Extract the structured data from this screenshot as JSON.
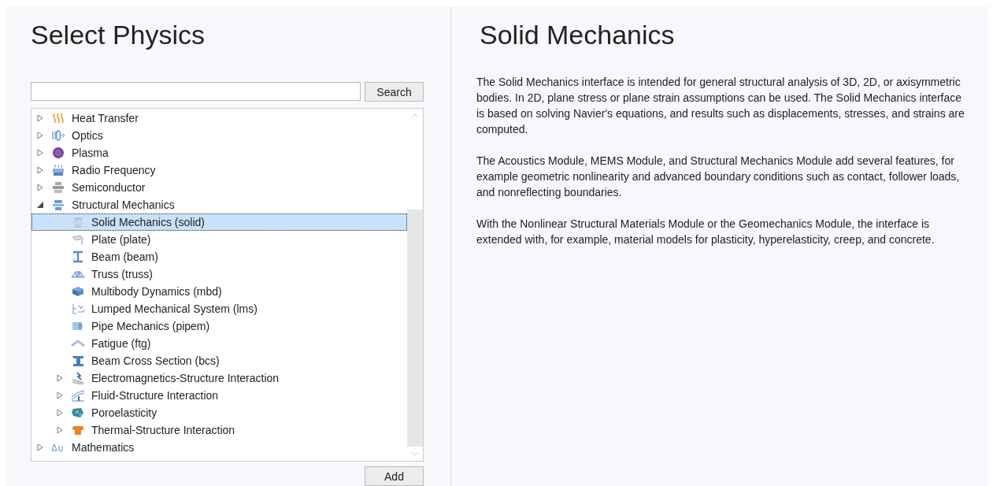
{
  "left_panel": {
    "title": "Select Physics",
    "search": {
      "button": "Search"
    },
    "tree": [
      {
        "label": "Heat Transfer",
        "kind": "folder",
        "expanded": false,
        "selected": false
      },
      {
        "label": "Optics",
        "kind": "folder",
        "expanded": false,
        "selected": false
      },
      {
        "label": "Plasma",
        "kind": "folder",
        "expanded": false,
        "selected": false
      },
      {
        "label": "Radio Frequency",
        "kind": "folder",
        "expanded": false,
        "selected": false
      },
      {
        "label": "Semiconductor",
        "kind": "folder",
        "expanded": false,
        "selected": false
      },
      {
        "label": "Structural Mechanics",
        "kind": "folder",
        "expanded": true,
        "selected": false,
        "children": [
          {
            "label": "Solid Mechanics (solid)",
            "kind": "leaf",
            "selected": true
          },
          {
            "label": "Plate (plate)",
            "kind": "leaf",
            "selected": false
          },
          {
            "label": "Beam (beam)",
            "kind": "leaf",
            "selected": false
          },
          {
            "label": "Truss (truss)",
            "kind": "leaf",
            "selected": false
          },
          {
            "label": "Multibody Dynamics (mbd)",
            "kind": "leaf",
            "selected": false
          },
          {
            "label": "Lumped Mechanical System (lms)",
            "kind": "leaf",
            "selected": false
          },
          {
            "label": "Pipe Mechanics (pipem)",
            "kind": "leaf",
            "selected": false
          },
          {
            "label": "Fatigue (ftg)",
            "kind": "leaf",
            "selected": false
          },
          {
            "label": "Beam Cross Section (bcs)",
            "kind": "leaf",
            "selected": false
          },
          {
            "label": "Electromagnetics-Structure Interaction",
            "kind": "folder",
            "expanded": false,
            "selected": false
          },
          {
            "label": "Fluid-Structure Interaction",
            "kind": "folder",
            "expanded": false,
            "selected": false
          },
          {
            "label": "Poroelasticity",
            "kind": "folder",
            "expanded": false,
            "selected": false
          },
          {
            "label": "Thermal-Structure Interaction",
            "kind": "folder",
            "expanded": false,
            "selected": false
          }
        ]
      },
      {
        "label": "Mathematics",
        "kind": "folder",
        "expanded": false,
        "selected": false
      }
    ],
    "add_button": "Add"
  },
  "right_panel": {
    "title": "Solid Mechanics",
    "paragraphs": [
      "The Solid Mechanics interface is intended for general structural analysis of 3D, 2D, or axisymmetric bodies. In 2D, plane stress or plane strain assumptions can be used. The Solid Mechanics interface is based on solving Navier's equations, and results such as displacements, stresses, and strains are computed.",
      "The Acoustics Module, MEMS Module, and Structural Mechanics Module add several features, for example geometric nonlinearity and advanced boundary conditions such as contact, follower loads, and nonreflecting boundaries.",
      "With the Nonlinear Structural Materials Module or the Geomechanics Module, the interface is extended with, for example, material models for plasticity, hyperelasticity, creep, and concrete."
    ]
  }
}
